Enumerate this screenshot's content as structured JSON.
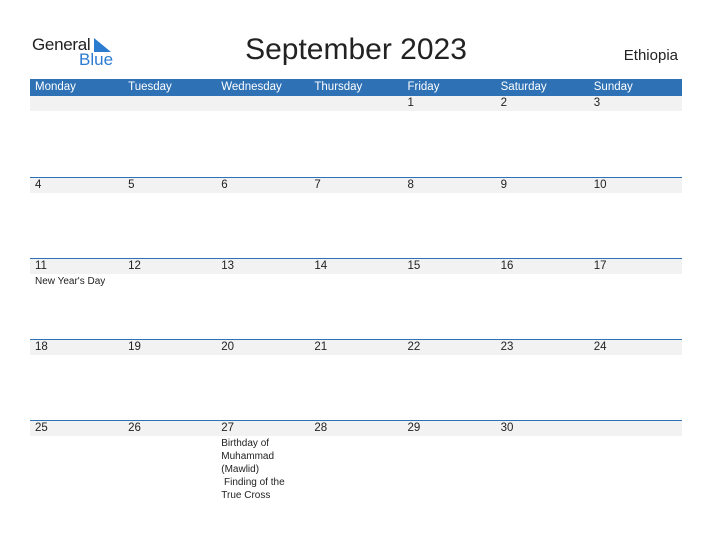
{
  "logo": {
    "line1": "General",
    "line2": "Blue"
  },
  "title": "September 2023",
  "country": "Ethiopia",
  "colors": {
    "header_bg": "#2e71b5",
    "brand_blue": "#2b7bd0",
    "daynum_bg": "#f2f2f2"
  },
  "weekdays": [
    "Monday",
    "Tuesday",
    "Wednesday",
    "Thursday",
    "Friday",
    "Saturday",
    "Sunday"
  ],
  "weeks": [
    {
      "days": [
        {
          "num": "",
          "events": ""
        },
        {
          "num": "",
          "events": ""
        },
        {
          "num": "",
          "events": ""
        },
        {
          "num": "",
          "events": ""
        },
        {
          "num": "1",
          "events": ""
        },
        {
          "num": "2",
          "events": ""
        },
        {
          "num": "3",
          "events": ""
        }
      ]
    },
    {
      "days": [
        {
          "num": "4",
          "events": ""
        },
        {
          "num": "5",
          "events": ""
        },
        {
          "num": "6",
          "events": ""
        },
        {
          "num": "7",
          "events": ""
        },
        {
          "num": "8",
          "events": ""
        },
        {
          "num": "9",
          "events": ""
        },
        {
          "num": "10",
          "events": ""
        }
      ]
    },
    {
      "days": [
        {
          "num": "11",
          "events": "New Year's Day"
        },
        {
          "num": "12",
          "events": ""
        },
        {
          "num": "13",
          "events": ""
        },
        {
          "num": "14",
          "events": ""
        },
        {
          "num": "15",
          "events": ""
        },
        {
          "num": "16",
          "events": ""
        },
        {
          "num": "17",
          "events": ""
        }
      ]
    },
    {
      "days": [
        {
          "num": "18",
          "events": ""
        },
        {
          "num": "19",
          "events": ""
        },
        {
          "num": "20",
          "events": ""
        },
        {
          "num": "21",
          "events": ""
        },
        {
          "num": "22",
          "events": ""
        },
        {
          "num": "23",
          "events": ""
        },
        {
          "num": "24",
          "events": ""
        }
      ]
    },
    {
      "days": [
        {
          "num": "25",
          "events": ""
        },
        {
          "num": "26",
          "events": ""
        },
        {
          "num": "27",
          "events": "Birthday of Muhammad (Mawlid)\n Finding of the True Cross"
        },
        {
          "num": "28",
          "events": ""
        },
        {
          "num": "29",
          "events": ""
        },
        {
          "num": "30",
          "events": ""
        },
        {
          "num": "",
          "events": ""
        }
      ]
    }
  ]
}
